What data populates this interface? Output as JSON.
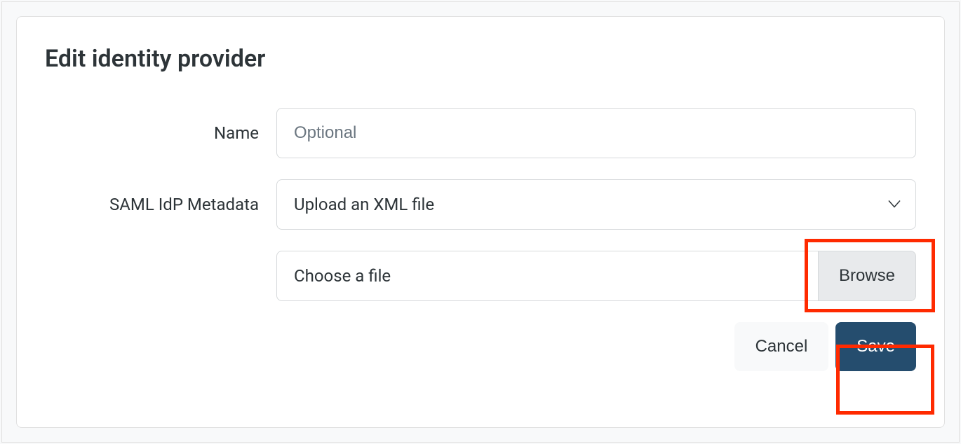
{
  "page": {
    "title": "Edit identity provider"
  },
  "form": {
    "name": {
      "label": "Name",
      "placeholder": "Optional",
      "value": ""
    },
    "metadata": {
      "label": "SAML IdP Metadata",
      "selected": "Upload an XML file"
    },
    "file": {
      "placeholder": "Choose a file",
      "browse_label": "Browse"
    }
  },
  "actions": {
    "cancel": "Cancel",
    "save": "Save"
  }
}
